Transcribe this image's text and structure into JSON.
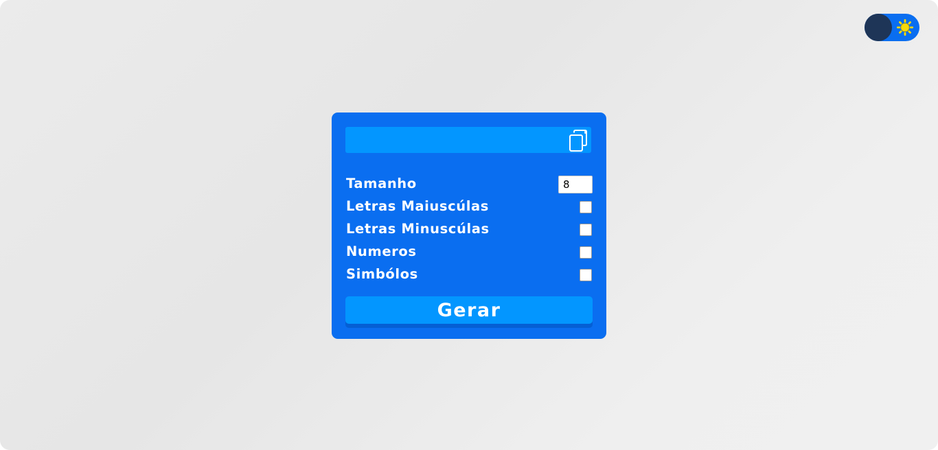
{
  "theme_toggle": {
    "icon": "sun-icon",
    "knob_color": "#1e3557",
    "track_color": "#0a6ef0",
    "sun_color": "#f5d90a"
  },
  "generator": {
    "password_output": {
      "value": "",
      "placeholder": ""
    },
    "copy_icon": "copy-icon",
    "length": {
      "label": "Tamanho",
      "value": "8"
    },
    "options": [
      {
        "label": "Letras Maiuscúlas",
        "checked": false
      },
      {
        "label": "Letras Minuscúlas",
        "checked": false
      },
      {
        "label": "Numeros",
        "checked": false
      },
      {
        "label": "Simbólos",
        "checked": false
      }
    ],
    "generate_label": "Gerar"
  },
  "colors": {
    "card": "#0a6ef0",
    "field": "#0396ff",
    "button_shadow": "#055fd4"
  }
}
